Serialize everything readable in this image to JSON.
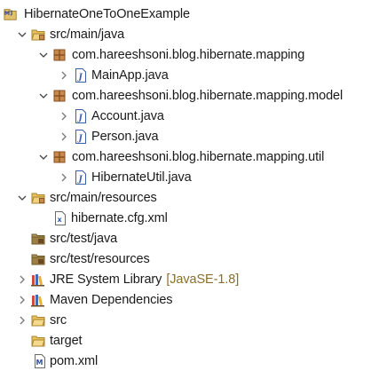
{
  "tree": {
    "project_name": "HibernateOneToOneExample",
    "main_java": "src/main/java",
    "pkg_mapping": "com.hareeshsoni.blog.hibernate.mapping",
    "file_mainapp": "MainApp.java",
    "pkg_model": "com.hareeshsoni.blog.hibernate.mapping.model",
    "file_account": "Account.java",
    "file_person": "Person.java",
    "pkg_util": "com.hareeshsoni.blog.hibernate.mapping.util",
    "file_hibutil": "HibernateUtil.java",
    "main_resources": "src/main/resources",
    "file_cfg": "hibernate.cfg.xml",
    "test_java": "src/test/java",
    "test_resources": "src/test/resources",
    "jre_library": "JRE System Library",
    "jre_version": "[JavaSE-1.8]",
    "maven_deps": "Maven Dependencies",
    "src": "src",
    "target": "target",
    "pom": "pom.xml"
  },
  "colors": {
    "folder": "#e8c15e",
    "package": "#a0522d",
    "java_file_border": "#3b5ea8",
    "decoration": "#8a6f2c"
  }
}
